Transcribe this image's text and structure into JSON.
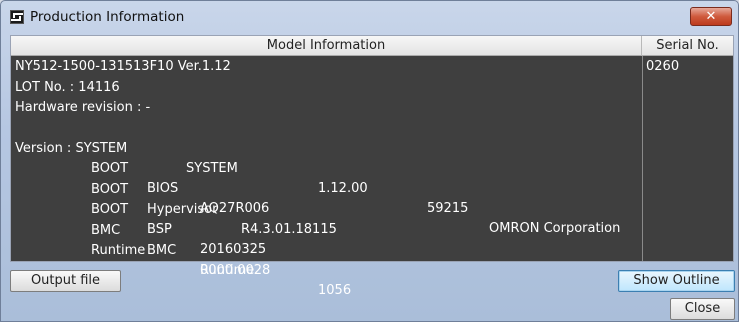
{
  "window": {
    "title": "Production Information",
    "close_glyph": "✕",
    "icon": "app-window-icon"
  },
  "table": {
    "headers": {
      "model": "Model Information",
      "serial": "Serial No."
    },
    "model_lines": {
      "model": "NY512-1500-131513F10 Ver.1.12",
      "lot": "LOT No. : 14116",
      "hardware": "Hardware revision : -"
    },
    "version_rows": [
      {
        "c1": "Version : SYSTEM",
        "c2": "SYSTEM",
        "c3": "1.12.00",
        "c4": "59215",
        "c5": "OMRON Corporation"
      },
      {
        "c1": "BOOT",
        "c2": "BIOS",
        "c3": "AQ27R006"
      },
      {
        "c1": "BOOT",
        "c2": "Hypervisor",
        "c3": "R4.3.01.18115"
      },
      {
        "c1": "BOOT",
        "c2": "BSP",
        "c3": "20160325"
      },
      {
        "c1": "BMC",
        "c2": "BMC",
        "c3": "0000.0028"
      },
      {
        "c1": "Runtime",
        "c2": "Runtime",
        "c3": "1056"
      }
    ],
    "serial_value": "0260"
  },
  "buttons": {
    "output_file": "Output file",
    "show_outline": "Show Outline",
    "close": "Close"
  }
}
